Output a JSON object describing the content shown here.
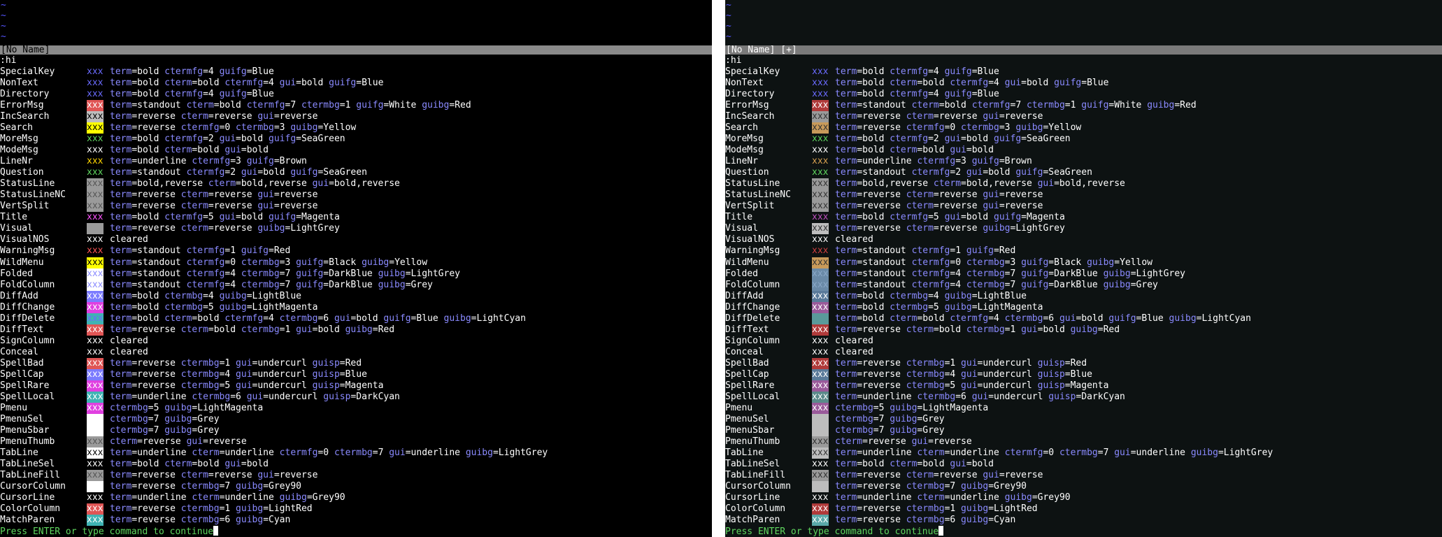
{
  "tildes": [
    "~",
    "~",
    "~",
    "~"
  ],
  "status_left": "[No Name]",
  "status_right": "[No Name] [+]",
  "command": ":hi",
  "prompt": "Press ENTER or type command to continue",
  "groups": [
    {
      "name": "SpecialKey",
      "xxx": "xxx",
      "fg": "#6b6bff",
      "bg": "",
      "attrs": [
        [
          "term",
          "bold"
        ],
        [
          "ctermfg",
          "4"
        ],
        [
          "guifg",
          "Blue"
        ]
      ]
    },
    {
      "name": "NonText",
      "xxx": "xxx",
      "fg": "#6b6bff",
      "bg": "",
      "attrs": [
        [
          "term",
          "bold"
        ],
        [
          "cterm",
          "bold"
        ],
        [
          "ctermfg",
          "4"
        ],
        [
          "gui",
          "bold"
        ],
        [
          "guifg",
          "Blue"
        ]
      ]
    },
    {
      "name": "Directory",
      "xxx": "xxx",
      "fg": "#6b6bff",
      "bg": "",
      "attrs": [
        [
          "term",
          "bold"
        ],
        [
          "ctermfg",
          "4"
        ],
        [
          "guifg",
          "Blue"
        ]
      ]
    },
    {
      "name": "ErrorMsg",
      "xxx": "xxx",
      "fg": "#ffffff",
      "bg": "#e05555",
      "attrs": [
        [
          "term",
          "standout"
        ],
        [
          "cterm",
          "bold"
        ],
        [
          "ctermfg",
          "7"
        ],
        [
          "ctermbg",
          "1"
        ],
        [
          "guifg",
          "White"
        ],
        [
          "guibg",
          "Red"
        ]
      ]
    },
    {
      "name": "IncSearch",
      "xxx": "xxx",
      "fg": "#000000",
      "bg": "#bdbdbd",
      "attrs": [
        [
          "term",
          "reverse"
        ],
        [
          "cterm",
          "reverse"
        ],
        [
          "gui",
          "reverse"
        ]
      ]
    },
    {
      "name": "Search",
      "xxx": "xxx",
      "fg": "#000000",
      "bg": "#ffff00",
      "attrs": [
        [
          "term",
          "reverse"
        ],
        [
          "ctermfg",
          "0"
        ],
        [
          "ctermbg",
          "3"
        ],
        [
          "guibg",
          "Yellow"
        ]
      ]
    },
    {
      "name": "MoreMsg",
      "xxx": "xxx",
      "fg": "#5fd75f",
      "bg": "",
      "attrs": [
        [
          "term",
          "bold"
        ],
        [
          "ctermfg",
          "2"
        ],
        [
          "gui",
          "bold"
        ],
        [
          "guifg",
          "SeaGreen"
        ]
      ]
    },
    {
      "name": "ModeMsg",
      "xxx": "xxx",
      "fg": "#ffffff",
      "bg": "",
      "attrs": [
        [
          "term",
          "bold"
        ],
        [
          "cterm",
          "bold"
        ],
        [
          "gui",
          "bold"
        ]
      ]
    },
    {
      "name": "LineNr",
      "xxx": "xxx",
      "fg": "#ffd700",
      "bg": "",
      "attrs": [
        [
          "term",
          "underline"
        ],
        [
          "ctermfg",
          "3"
        ],
        [
          "guifg",
          "Brown"
        ]
      ]
    },
    {
      "name": "Question",
      "xxx": "xxx",
      "fg": "#5fd75f",
      "bg": "",
      "attrs": [
        [
          "term",
          "standout"
        ],
        [
          "ctermfg",
          "2"
        ],
        [
          "gui",
          "bold"
        ],
        [
          "guifg",
          "SeaGreen"
        ]
      ]
    },
    {
      "name": "StatusLine",
      "xxx": "xxx",
      "fg": "#555555",
      "bg": "#9a9a9a",
      "attrs": [
        [
          "term",
          "bold,reverse"
        ],
        [
          "cterm",
          "bold,reverse"
        ],
        [
          "gui",
          "bold,reverse"
        ]
      ]
    },
    {
      "name": "StatusLineNC",
      "xxx": "xxx",
      "fg": "#555555",
      "bg": "#9a9a9a",
      "attrs": [
        [
          "term",
          "reverse"
        ],
        [
          "cterm",
          "reverse"
        ],
        [
          "gui",
          "reverse"
        ]
      ]
    },
    {
      "name": "VertSplit",
      "xxx": "xxx",
      "fg": "#555555",
      "bg": "#9a9a9a",
      "attrs": [
        [
          "term",
          "reverse"
        ],
        [
          "cterm",
          "reverse"
        ],
        [
          "gui",
          "reverse"
        ]
      ]
    },
    {
      "name": "Title",
      "xxx": "xxx",
      "fg": "#ff55ff",
      "bg": "",
      "attrs": [
        [
          "term",
          "bold"
        ],
        [
          "ctermfg",
          "5"
        ],
        [
          "gui",
          "bold"
        ],
        [
          "guifg",
          "Magenta"
        ]
      ]
    },
    {
      "name": "Visual",
      "xxx": "xxx",
      "fg": "#9a9a9a",
      "bg": "#9a9a9a",
      "attrs": [
        [
          "term",
          "reverse"
        ],
        [
          "cterm",
          "reverse"
        ],
        [
          "guibg",
          "LightGrey"
        ]
      ]
    },
    {
      "name": "VisualNOS",
      "xxx": "xxx",
      "fg": "#ffffff",
      "bg": "",
      "attrs": [
        [
          "cleared",
          ""
        ]
      ]
    },
    {
      "name": "WarningMsg",
      "xxx": "xxx",
      "fg": "#ff5555",
      "bg": "",
      "attrs": [
        [
          "term",
          "standout"
        ],
        [
          "ctermfg",
          "1"
        ],
        [
          "guifg",
          "Red"
        ]
      ]
    },
    {
      "name": "WildMenu",
      "xxx": "xxx",
      "fg": "#000000",
      "bg": "#ffff00",
      "attrs": [
        [
          "term",
          "standout"
        ],
        [
          "ctermfg",
          "0"
        ],
        [
          "ctermbg",
          "3"
        ],
        [
          "guifg",
          "Black"
        ],
        [
          "guibg",
          "Yellow"
        ]
      ]
    },
    {
      "name": "Folded",
      "xxx": "xxx",
      "fg": "#8a8aff",
      "bg": "#ffffff",
      "attrs": [
        [
          "term",
          "standout"
        ],
        [
          "ctermfg",
          "4"
        ],
        [
          "ctermbg",
          "7"
        ],
        [
          "guifg",
          "DarkBlue"
        ],
        [
          "guibg",
          "LightGrey"
        ]
      ]
    },
    {
      "name": "FoldColumn",
      "xxx": "xxx",
      "fg": "#8a8aff",
      "bg": "#ffffff",
      "attrs": [
        [
          "term",
          "standout"
        ],
        [
          "ctermfg",
          "4"
        ],
        [
          "ctermbg",
          "7"
        ],
        [
          "guifg",
          "DarkBlue"
        ],
        [
          "guibg",
          "Grey"
        ]
      ]
    },
    {
      "name": "DiffAdd",
      "xxx": "xxx",
      "fg": "#ffffff",
      "bg": "#7b7bff",
      "attrs": [
        [
          "term",
          "bold"
        ],
        [
          "ctermbg",
          "4"
        ],
        [
          "guibg",
          "LightBlue"
        ]
      ]
    },
    {
      "name": "DiffChange",
      "xxx": "xxx",
      "fg": "#ffffff",
      "bg": "#e040e0",
      "attrs": [
        [
          "term",
          "bold"
        ],
        [
          "ctermbg",
          "5"
        ],
        [
          "guibg",
          "LightMagenta"
        ]
      ]
    },
    {
      "name": "DiffDelete",
      "xxx": "xxx",
      "fg": "#6b6bff",
      "bg": "#3fb3b3",
      "attrs": [
        [
          "term",
          "bold"
        ],
        [
          "cterm",
          "bold"
        ],
        [
          "ctermfg",
          "4"
        ],
        [
          "ctermbg",
          "6"
        ],
        [
          "gui",
          "bold"
        ],
        [
          "guifg",
          "Blue"
        ],
        [
          "guibg",
          "LightCyan"
        ]
      ]
    },
    {
      "name": "DiffText",
      "xxx": "xxx",
      "fg": "#ffffff",
      "bg": "#e05555",
      "attrs": [
        [
          "term",
          "reverse"
        ],
        [
          "cterm",
          "bold"
        ],
        [
          "ctermbg",
          "1"
        ],
        [
          "gui",
          "bold"
        ],
        [
          "guibg",
          "Red"
        ]
      ]
    },
    {
      "name": "SignColumn",
      "xxx": "xxx",
      "fg": "#ffffff",
      "bg": "",
      "attrs": [
        [
          "cleared",
          ""
        ]
      ]
    },
    {
      "name": "Conceal",
      "xxx": "xxx",
      "fg": "#ffffff",
      "bg": "",
      "attrs": [
        [
          "cleared",
          ""
        ]
      ]
    },
    {
      "name": "SpellBad",
      "xxx": "xxx",
      "fg": "#ffffff",
      "bg": "#e05555",
      "attrs": [
        [
          "term",
          "reverse"
        ],
        [
          "ctermbg",
          "1"
        ],
        [
          "gui",
          "undercurl"
        ],
        [
          "guisp",
          "Red"
        ]
      ]
    },
    {
      "name": "SpellCap",
      "xxx": "xxx",
      "fg": "#ffffff",
      "bg": "#7b7bff",
      "attrs": [
        [
          "term",
          "reverse"
        ],
        [
          "ctermbg",
          "4"
        ],
        [
          "gui",
          "undercurl"
        ],
        [
          "guisp",
          "Blue"
        ]
      ]
    },
    {
      "name": "SpellRare",
      "xxx": "xxx",
      "fg": "#ffffff",
      "bg": "#e040e0",
      "attrs": [
        [
          "term",
          "reverse"
        ],
        [
          "ctermbg",
          "5"
        ],
        [
          "gui",
          "undercurl"
        ],
        [
          "guisp",
          "Magenta"
        ]
      ]
    },
    {
      "name": "SpellLocal",
      "xxx": "xxx",
      "fg": "#ffffff",
      "bg": "#3fb3b3",
      "attrs": [
        [
          "term",
          "underline"
        ],
        [
          "ctermbg",
          "6"
        ],
        [
          "gui",
          "undercurl"
        ],
        [
          "guisp",
          "DarkCyan"
        ]
      ]
    },
    {
      "name": "Pmenu",
      "xxx": "xxx",
      "fg": "#ffffff",
      "bg": "#e040e0",
      "attrs": [
        [
          "ctermbg",
          "5"
        ],
        [
          "guibg",
          "LightMagenta"
        ]
      ]
    },
    {
      "name": "PmenuSel",
      "xxx": "xxx",
      "fg": "#ffffff",
      "bg": "#ffffff",
      "attrs": [
        [
          "ctermbg",
          "7"
        ],
        [
          "guibg",
          "Grey"
        ]
      ]
    },
    {
      "name": "PmenuSbar",
      "xxx": "xxx",
      "fg": "#ffffff",
      "bg": "#ffffff",
      "attrs": [
        [
          "ctermbg",
          "7"
        ],
        [
          "guibg",
          "Grey"
        ]
      ]
    },
    {
      "name": "PmenuThumb",
      "xxx": "xxx",
      "fg": "#555555",
      "bg": "#9a9a9a",
      "attrs": [
        [
          "cterm",
          "reverse"
        ],
        [
          "gui",
          "reverse"
        ]
      ]
    },
    {
      "name": "TabLine",
      "xxx": "xxx",
      "fg": "#000000",
      "bg": "#ffffff",
      "attrs": [
        [
          "term",
          "underline"
        ],
        [
          "cterm",
          "underline"
        ],
        [
          "ctermfg",
          "0"
        ],
        [
          "ctermbg",
          "7"
        ],
        [
          "gui",
          "underline"
        ],
        [
          "guibg",
          "LightGrey"
        ]
      ]
    },
    {
      "name": "TabLineSel",
      "xxx": "xxx",
      "fg": "#ffffff",
      "bg": "",
      "attrs": [
        [
          "term",
          "bold"
        ],
        [
          "cterm",
          "bold"
        ],
        [
          "gui",
          "bold"
        ]
      ]
    },
    {
      "name": "TabLineFill",
      "xxx": "xxx",
      "fg": "#555555",
      "bg": "#9a9a9a",
      "attrs": [
        [
          "term",
          "reverse"
        ],
        [
          "cterm",
          "reverse"
        ],
        [
          "gui",
          "reverse"
        ]
      ]
    },
    {
      "name": "CursorColumn",
      "xxx": "xxx",
      "fg": "#ffffff",
      "bg": "#ffffff",
      "attrs": [
        [
          "term",
          "reverse"
        ],
        [
          "ctermbg",
          "7"
        ],
        [
          "guibg",
          "Grey90"
        ]
      ]
    },
    {
      "name": "CursorLine",
      "xxx": "xxx",
      "fg": "#ffffff",
      "bg": "",
      "attrs": [
        [
          "term",
          "underline"
        ],
        [
          "cterm",
          "underline"
        ],
        [
          "guibg",
          "Grey90"
        ]
      ]
    },
    {
      "name": "ColorColumn",
      "xxx": "xxx",
      "fg": "#ffffff",
      "bg": "#e05555",
      "attrs": [
        [
          "term",
          "reverse"
        ],
        [
          "ctermbg",
          "1"
        ],
        [
          "guibg",
          "LightRed"
        ]
      ]
    },
    {
      "name": "MatchParen",
      "xxx": "xxx",
      "fg": "#ffffff",
      "bg": "#3fb3b3",
      "attrs": [
        [
          "term",
          "reverse"
        ],
        [
          "ctermbg",
          "6"
        ],
        [
          "guibg",
          "Cyan"
        ]
      ]
    }
  ],
  "right_xxx": [
    {
      "fg": "#6b6bff",
      "bg": ""
    },
    {
      "fg": "#6b6bff",
      "bg": ""
    },
    {
      "fg": "#6b6bff",
      "bg": ""
    },
    {
      "fg": "#ffffff",
      "bg": "#b03a3a"
    },
    {
      "fg": "#333333",
      "bg": "#9a9a9a"
    },
    {
      "fg": "#333333",
      "bg": "#c89a5a"
    },
    {
      "fg": "#5fd75f",
      "bg": ""
    },
    {
      "fg": "#ffffff",
      "bg": ""
    },
    {
      "fg": "#d7a050",
      "bg": ""
    },
    {
      "fg": "#5fd75f",
      "bg": ""
    },
    {
      "fg": "#333333",
      "bg": "#9a9a9a"
    },
    {
      "fg": "#333333",
      "bg": "#9a9a9a"
    },
    {
      "fg": "#333333",
      "bg": "#9a9a9a"
    },
    {
      "fg": "#c050c0",
      "bg": ""
    },
    {
      "fg": "#333333",
      "bg": "#bdbdbd"
    },
    {
      "fg": "#ffffff",
      "bg": ""
    },
    {
      "fg": "#d04040",
      "bg": ""
    },
    {
      "fg": "#333333",
      "bg": "#c89a5a"
    },
    {
      "fg": "#8aa8c8",
      "bg": "#6a8aa8"
    },
    {
      "fg": "#8aa8c8",
      "bg": "#6a8aa8"
    },
    {
      "fg": "#ffffff",
      "bg": "#5a7a9a"
    },
    {
      "fg": "#ffffff",
      "bg": "#9a5a9a"
    },
    {
      "fg": "#5a9a9a",
      "bg": "#5a9a9a"
    },
    {
      "fg": "#ffffff",
      "bg": "#b03a3a"
    },
    {
      "fg": "#ffffff",
      "bg": ""
    },
    {
      "fg": "#ffffff",
      "bg": ""
    },
    {
      "fg": "#ffffff",
      "bg": "#b03a3a"
    },
    {
      "fg": "#ffffff",
      "bg": "#5a7a9a"
    },
    {
      "fg": "#ffffff",
      "bg": "#9a5a9a"
    },
    {
      "fg": "#ffffff",
      "bg": "#5a8a8a"
    },
    {
      "fg": "#ffffff",
      "bg": "#9a5a9a"
    },
    {
      "fg": "#bdbdbd",
      "bg": "#bdbdbd"
    },
    {
      "fg": "#bdbdbd",
      "bg": "#bdbdbd"
    },
    {
      "fg": "#333333",
      "bg": "#9a9a9a"
    },
    {
      "fg": "#333333",
      "bg": "#bdbdbd"
    },
    {
      "fg": "#ffffff",
      "bg": ""
    },
    {
      "fg": "#333333",
      "bg": "#9a9a9a"
    },
    {
      "fg": "#bdbdbd",
      "bg": "#bdbdbd"
    },
    {
      "fg": "#ffffff",
      "bg": ""
    },
    {
      "fg": "#ffffff",
      "bg": "#b03a3a"
    },
    {
      "fg": "#ffffff",
      "bg": "#5aa8a8"
    }
  ],
  "colors": {
    "tilde": "#5555ff",
    "status_bg": "#8a8a8a",
    "attr_key": "#8a8aff",
    "prompt": "#5fd75f"
  }
}
